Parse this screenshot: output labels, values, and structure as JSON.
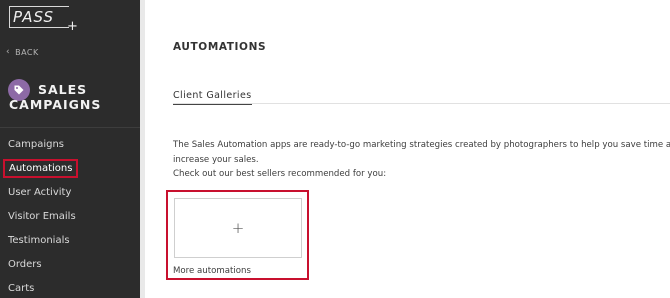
{
  "app": {
    "logo_text": "PASS",
    "logo_plus": "+"
  },
  "sidebar": {
    "back_label": "BACK",
    "section_title_line1": "SALES",
    "section_title_line2": "CAMPAIGNS",
    "items": [
      {
        "label": "Campaigns",
        "active": false
      },
      {
        "label": "Automations",
        "active": true
      },
      {
        "label": "User Activity",
        "active": false
      },
      {
        "label": "Visitor Emails",
        "active": false
      },
      {
        "label": "Testimonials",
        "active": false
      },
      {
        "label": "Orders",
        "active": false
      },
      {
        "label": "Carts",
        "active": false
      }
    ]
  },
  "main": {
    "title": "AUTOMATIONS",
    "tabs": [
      {
        "label": "Client Galleries",
        "active": true
      }
    ],
    "description": [
      "The Sales Automation apps are ready-to-go marketing strategies created by photographers to help you save time and",
      "increase your sales.",
      "Check out our best sellers recommended for you:"
    ],
    "add_card": {
      "icon": "+",
      "label": "More automations"
    }
  },
  "colors": {
    "sidebar_bg": "#2c2c2c",
    "highlight_red": "#c8102e",
    "tag_purple": "#8d6aa6"
  }
}
